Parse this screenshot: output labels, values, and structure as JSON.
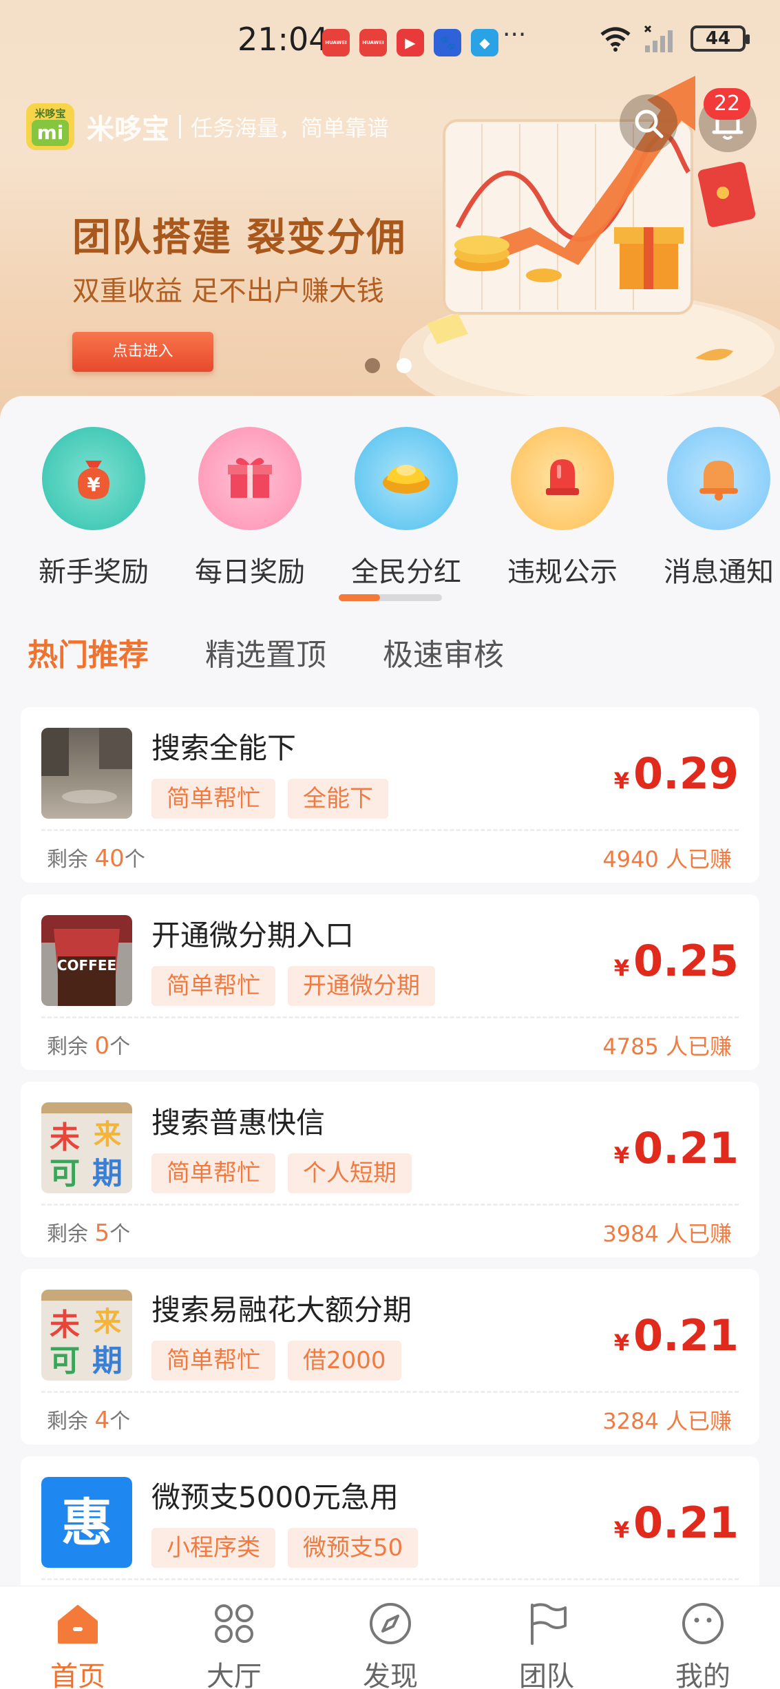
{
  "status_bar": {
    "time": "21:04",
    "apps": [
      {
        "icon": "huawei-app-icon",
        "color": "#e8413c",
        "text": "HUAWEI"
      },
      {
        "icon": "huawei-app-icon",
        "color": "#e8413c",
        "text": "HUAWEI"
      },
      {
        "icon": "video-app-icon",
        "color": "#e83a3a",
        "text": "▶"
      },
      {
        "icon": "baidu-app-icon",
        "color": "#2f62d8",
        "text": "🐾"
      },
      {
        "icon": "browser-app-icon",
        "color": "#2aa3e6",
        "text": "◆"
      }
    ],
    "more": "···",
    "battery": "44"
  },
  "brand": {
    "logo_top": "米哆宝",
    "logo_mid": "mi",
    "name": "米哆宝",
    "slogan": "任务海量，简单靠谱"
  },
  "header": {
    "notification_count": "22"
  },
  "banner": {
    "title": "团队搭建 裂变分佣",
    "subtitle": "双重收益 足不出户赚大钱",
    "button": "点击进入"
  },
  "quick_actions": [
    {
      "label": "新手奖励",
      "icon": "money-bag-icon",
      "bg1": "#7fe0d0",
      "bg2": "#2ec2ae"
    },
    {
      "label": "每日奖励",
      "icon": "gift-icon",
      "bg1": "#ffc2d6",
      "bg2": "#ff8fb0"
    },
    {
      "label": "全民分红",
      "icon": "gold-ingot-icon",
      "bg1": "#a9e3fb",
      "bg2": "#4fbfee"
    },
    {
      "label": "违规公示",
      "icon": "alarm-light-icon",
      "bg1": "#ffe3a6",
      "bg2": "#ffbf54"
    },
    {
      "label": "消息通知",
      "icon": "bell-icon",
      "bg1": "#bfe6ff",
      "bg2": "#79c7f8"
    }
  ],
  "tabs": [
    {
      "label": "热门推荐"
    },
    {
      "label": "精选置顶"
    },
    {
      "label": "极速审核"
    }
  ],
  "tasks": [
    {
      "title": "搜索全能下",
      "tags": [
        "简单帮忙",
        "全能下"
      ],
      "currency": "¥",
      "price": "0.29",
      "remain_label": "剩余",
      "remain": "40",
      "unit": "个",
      "earned": "4940 人已赚",
      "thumb": "floor-photo"
    },
    {
      "title": "开通微分期入口",
      "tags": [
        "简单帮忙",
        "开通微分期"
      ],
      "currency": "¥",
      "price": "0.25",
      "remain_label": "剩余",
      "remain": "0",
      "unit": "个",
      "earned": "4785 人已赚",
      "thumb": "coffee-photo"
    },
    {
      "title": "搜索普惠快信",
      "tags": [
        "简单帮忙",
        "个人短期"
      ],
      "currency": "¥",
      "price": "0.21",
      "remain_label": "剩余",
      "remain": "5",
      "unit": "个",
      "earned": "3984 人已赚",
      "thumb": "poster-photo"
    },
    {
      "title": "搜索易融花大额分期",
      "tags": [
        "简单帮忙",
        "借2000"
      ],
      "currency": "¥",
      "price": "0.21",
      "remain_label": "剩余",
      "remain": "4",
      "unit": "个",
      "earned": "3284 人已赚",
      "thumb": "poster-photo"
    },
    {
      "title": "微预支5000元急用",
      "tags": [
        "小程序类",
        "微预支50"
      ],
      "currency": "¥",
      "price": "0.21",
      "remain_label": "",
      "remain": "",
      "unit": "",
      "earned": "",
      "thumb": "hui-logo",
      "thumb_text": "惠"
    }
  ],
  "bottom_nav": [
    {
      "label": "首页",
      "icon": "home-icon",
      "active": true
    },
    {
      "label": "大厅",
      "icon": "grid-icon",
      "active": false
    },
    {
      "label": "发现",
      "icon": "compass-icon",
      "active": false
    },
    {
      "label": "团队",
      "icon": "flag-icon",
      "active": false
    },
    {
      "label": "我的",
      "icon": "smiley-icon",
      "active": false
    }
  ],
  "colors": {
    "accent": "#f0722f",
    "price": "#e02a1c",
    "tag_bg": "#fdece3"
  }
}
